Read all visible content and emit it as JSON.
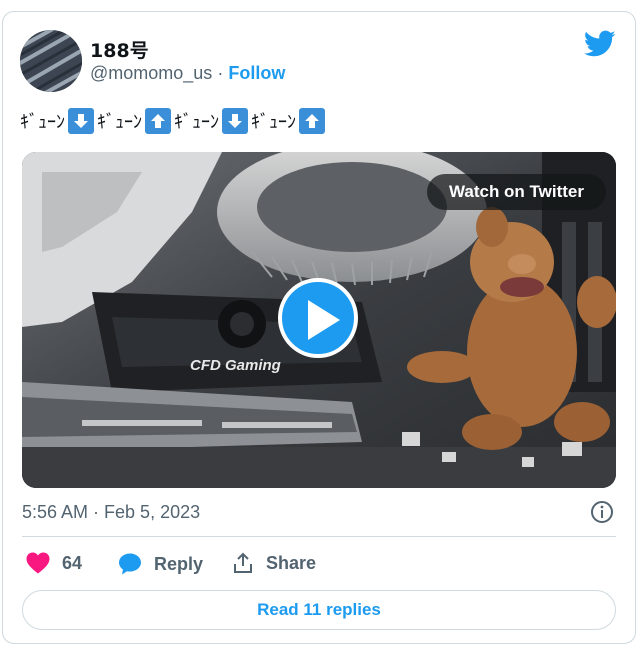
{
  "tweet": {
    "display_name": "188号",
    "handle": "@momomo_us",
    "separator": "·",
    "follow_label": "Follow",
    "text_segments": [
      "ｷﾞｭｰﾝ",
      "ｷﾞｭｰﾝ",
      "ｷﾞｭｰﾝ",
      "ｷﾞｭｰﾝ"
    ],
    "arrows": [
      "down-arrow-icon",
      "up-arrow-icon",
      "down-arrow-icon",
      "up-arrow-icon"
    ],
    "timestamp": "5:56 AM · Feb 5, 2023"
  },
  "media": {
    "watch_label": "Watch on Twitter",
    "board_label": "CFD Gaming"
  },
  "actions": {
    "like_count": "64",
    "reply_label": "Reply",
    "share_label": "Share",
    "read_replies_label": "Read 11 replies"
  },
  "colors": {
    "accent": "#1d9bf0",
    "like": "#f91880",
    "arrow_box": "#3a8fd8"
  }
}
